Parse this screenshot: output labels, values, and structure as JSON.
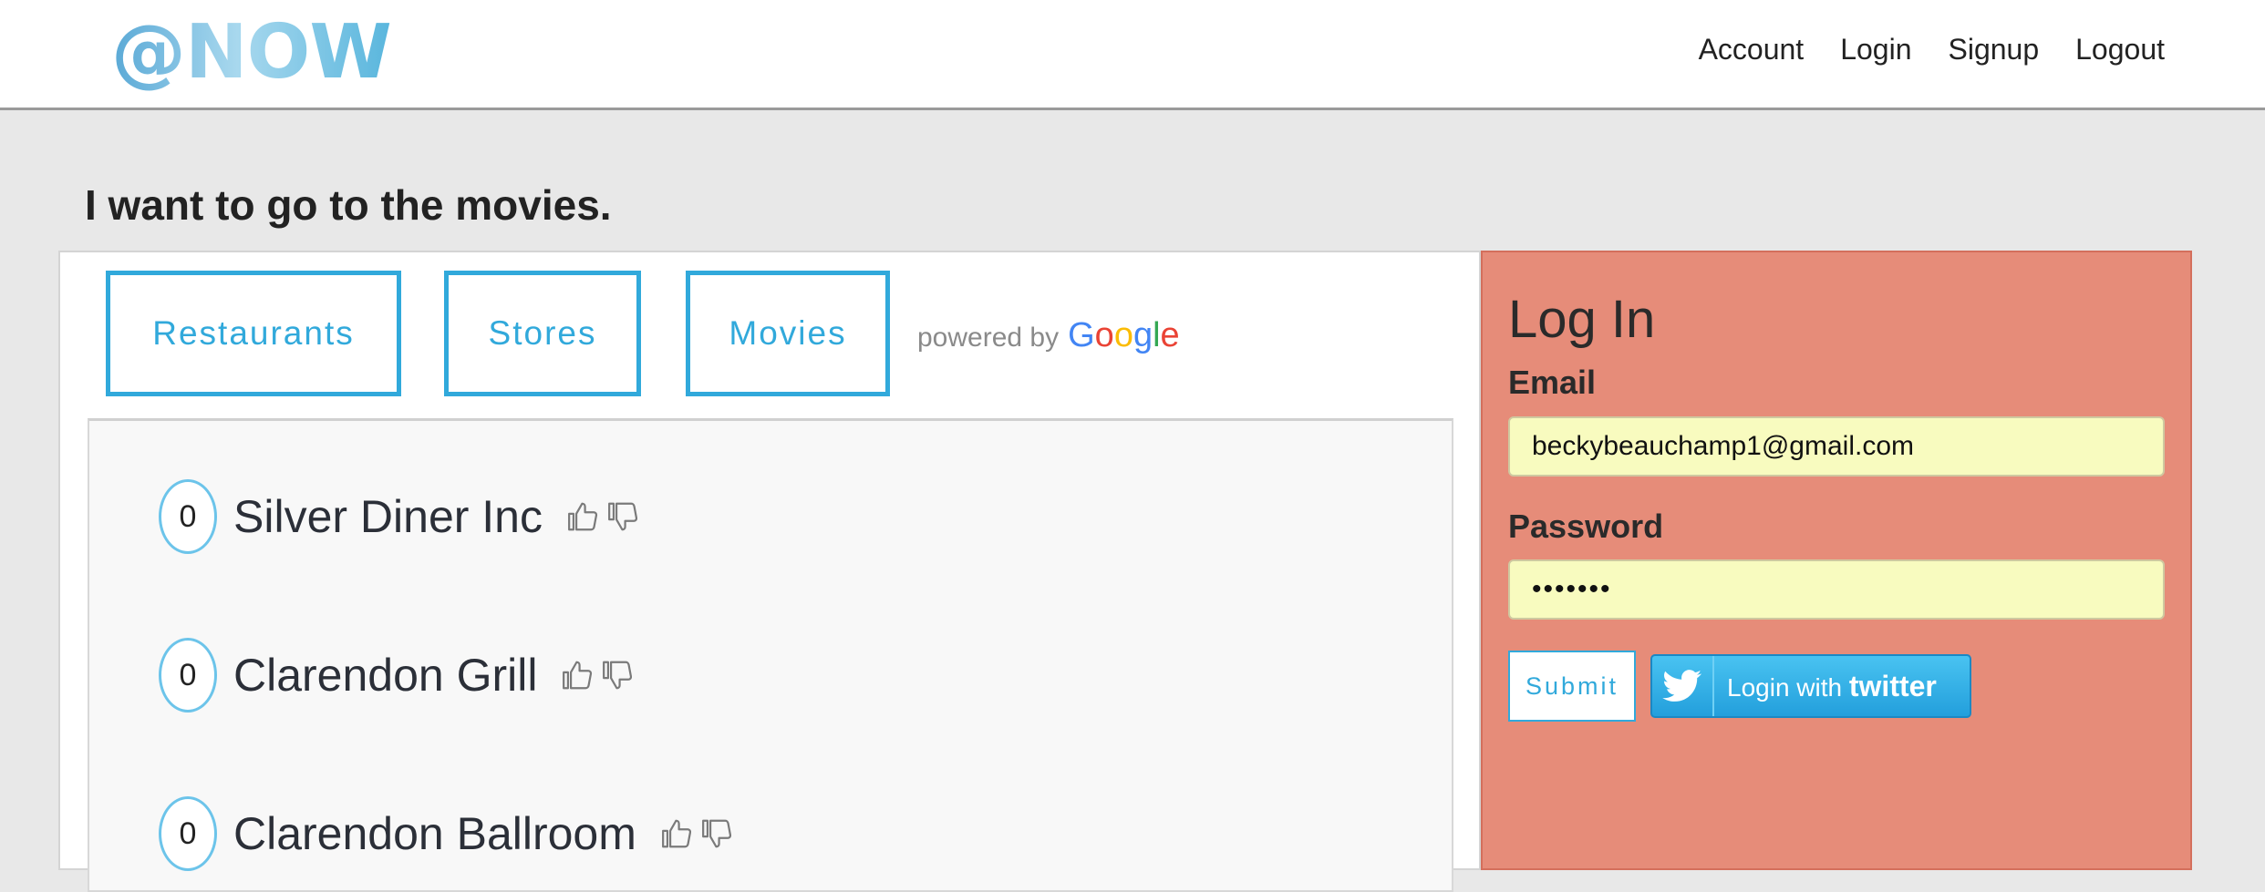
{
  "app": {
    "logo_text": "@NOW"
  },
  "nav": {
    "items": [
      "Account",
      "Login",
      "Signup",
      "Logout"
    ]
  },
  "page": {
    "title": "I want to go to the movies."
  },
  "categories": [
    "Restaurants",
    "Stores",
    "Movies"
  ],
  "powered_by": {
    "prefix": "powered by",
    "brand": [
      "G",
      "o",
      "o",
      "g",
      "l",
      "e"
    ]
  },
  "results": [
    {
      "score": "0",
      "name": "Silver Diner Inc"
    },
    {
      "score": "0",
      "name": "Clarendon Grill"
    },
    {
      "score": "0",
      "name": "Clarendon Ballroom"
    }
  ],
  "login": {
    "title": "Log In",
    "email_label": "Email",
    "email_value": "beckybeauchamp1@gmail.com",
    "password_label": "Password",
    "password_value": "•••••••",
    "submit_label": "Submit",
    "twitter_prefix": "Login with",
    "twitter_brand": "twitter"
  },
  "colors": {
    "accent": "#31a9db",
    "login_panel": "#e68c79",
    "autofill": "#f8fbbf",
    "twitter": "#239fdc"
  }
}
